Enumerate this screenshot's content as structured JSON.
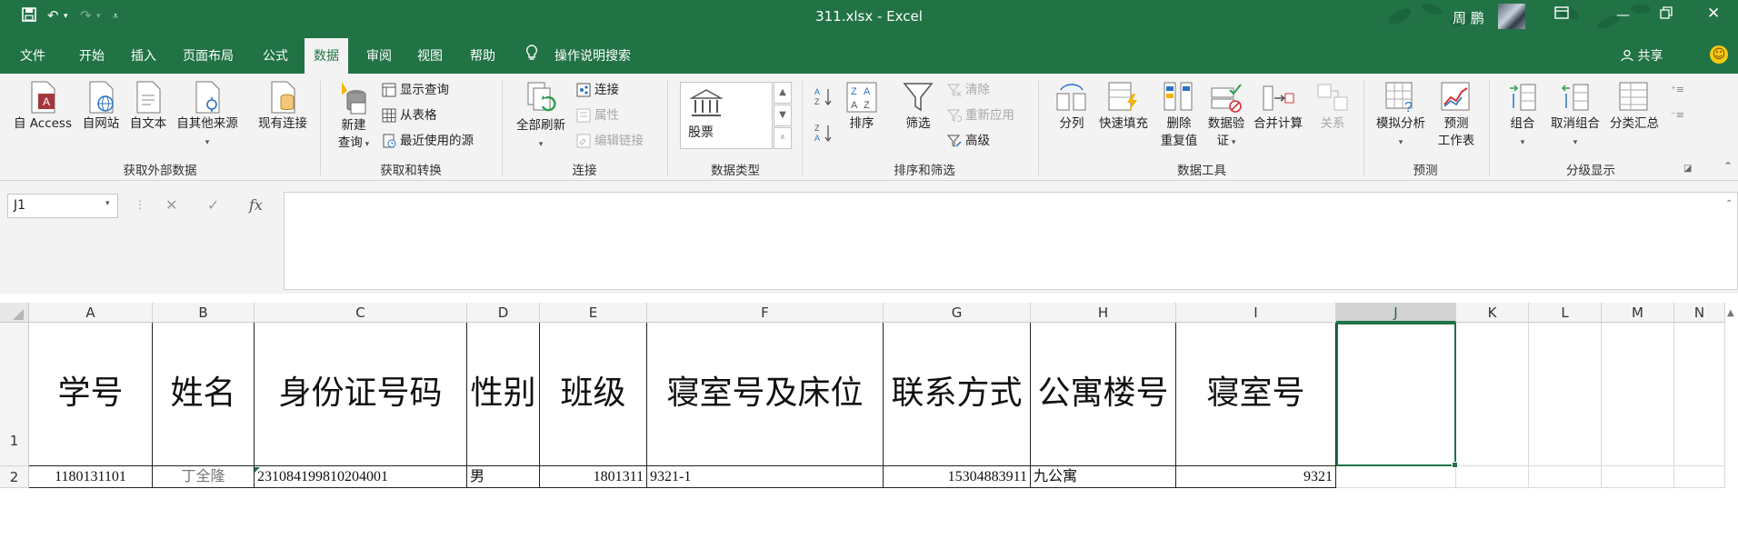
{
  "colors": {
    "excel_green": "#217346",
    "ribbon_bg": "#f3f3f3",
    "selection": "#217346"
  },
  "titlebar": {
    "title": "311.xlsx  -  Excel",
    "user": "周 鹏",
    "icons": [
      "save-icon",
      "undo-icon",
      "redo-icon",
      "customize-qat-icon",
      "ribbon-display-icon",
      "minimize-icon",
      "restore-icon",
      "close-icon"
    ]
  },
  "tabs": {
    "items": [
      "文件",
      "开始",
      "插入",
      "页面布局",
      "公式",
      "数据",
      "审阅",
      "视图",
      "帮助"
    ],
    "active": "数据",
    "tell_me": "操作说明搜索",
    "share": "共享"
  },
  "ribbon": {
    "get_external": {
      "label": "获取外部数据",
      "access": "自 Access",
      "web": "自网站",
      "text": "自文本",
      "other": "自其他来源",
      "existing": "现有连接"
    },
    "get_transform": {
      "label": "获取和转换",
      "new_query_1": "新建",
      "new_query_2": "查询",
      "show_queries": "显示查询",
      "from_table": "从表格",
      "recent_sources": "最近使用的源"
    },
    "connections": {
      "label": "连接",
      "refresh_all": "全部刷新",
      "connections": "连接",
      "properties": "属性",
      "edit_links": "编辑链接"
    },
    "data_types": {
      "label": "数据类型",
      "stocks": "股票"
    },
    "sort_filter": {
      "label": "排序和筛选",
      "sort": "排序",
      "filter": "筛选",
      "clear": "清除",
      "reapply": "重新应用",
      "advanced": "高级"
    },
    "data_tools": {
      "label": "数据工具",
      "text_to_columns": "分列",
      "flash_fill": "快速填充",
      "remove_dup_1": "删除",
      "remove_dup_2": "重复值",
      "validation_1": "数据验",
      "validation_2": "证",
      "consolidate": "合并计算",
      "relationships": "关系"
    },
    "forecast": {
      "label": "预测",
      "what_if": "模拟分析",
      "sheet_1": "预测",
      "sheet_2": "工作表"
    },
    "outline": {
      "label": "分级显示",
      "group": "组合",
      "ungroup": "取消组合",
      "subtotal": "分类汇总"
    }
  },
  "formula_bar": {
    "name_box": "J1",
    "formula": "",
    "fx": "fx"
  },
  "sheet": {
    "columns": [
      "A",
      "B",
      "C",
      "D",
      "E",
      "F",
      "G",
      "H",
      "I",
      "J",
      "K",
      "L",
      "M",
      "N"
    ],
    "selected_column": "J",
    "rows": [
      "1",
      "2"
    ],
    "header_row": [
      "学号",
      "姓名",
      "身份证号码",
      "性别",
      "班级",
      "寝室号及床位",
      "联系方式",
      "公寓楼号",
      "寝室号"
    ],
    "data_row": [
      "1180131101",
      "丁全隆",
      "231084199810204001",
      "男",
      "1801311",
      "9321-1",
      "15304883911",
      "九公寓",
      "9321"
    ]
  }
}
